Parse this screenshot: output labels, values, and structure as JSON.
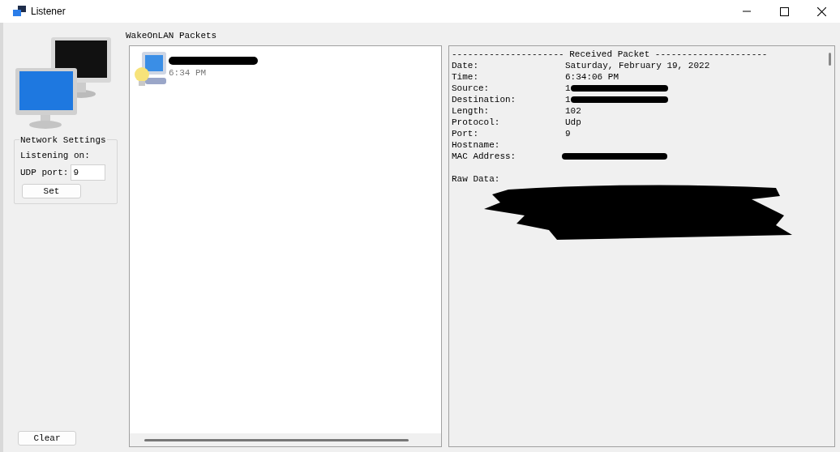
{
  "window": {
    "title": "Listener"
  },
  "network_settings": {
    "title": "Network Settings",
    "listening_label": "Listening on:",
    "port_label": "UDP port:",
    "port_value": "9",
    "set_button": "Set"
  },
  "packets_list": {
    "title": "WakeOnLAN Packets",
    "items": [
      {
        "name_redacted": true,
        "time": "6:34 PM",
        "selected": false
      }
    ]
  },
  "packet_detail": {
    "header": "--------------------- Received Packet ---------------------",
    "fields": [
      {
        "label": "Date:",
        "value": "Saturday, February 19, 2022",
        "redacted": false
      },
      {
        "label": "Time:",
        "value": "6:34:06 PM",
        "redacted": false
      },
      {
        "label": "Source:",
        "value": "1",
        "redacted": true
      },
      {
        "label": "Destination:",
        "value": "1",
        "redacted": true
      },
      {
        "label": "Length:",
        "value": "102",
        "redacted": false
      },
      {
        "label": "Protocol:",
        "value": "Udp",
        "redacted": false
      },
      {
        "label": "Port:",
        "value": "9",
        "redacted": false
      },
      {
        "label": "Hostname:",
        "redacted": false
      },
      {
        "label": "MAC Address:",
        "redacted": true
      }
    ],
    "raw_label": "Raw Data:",
    "raw_redacted": true
  },
  "clear_button": "Clear"
}
